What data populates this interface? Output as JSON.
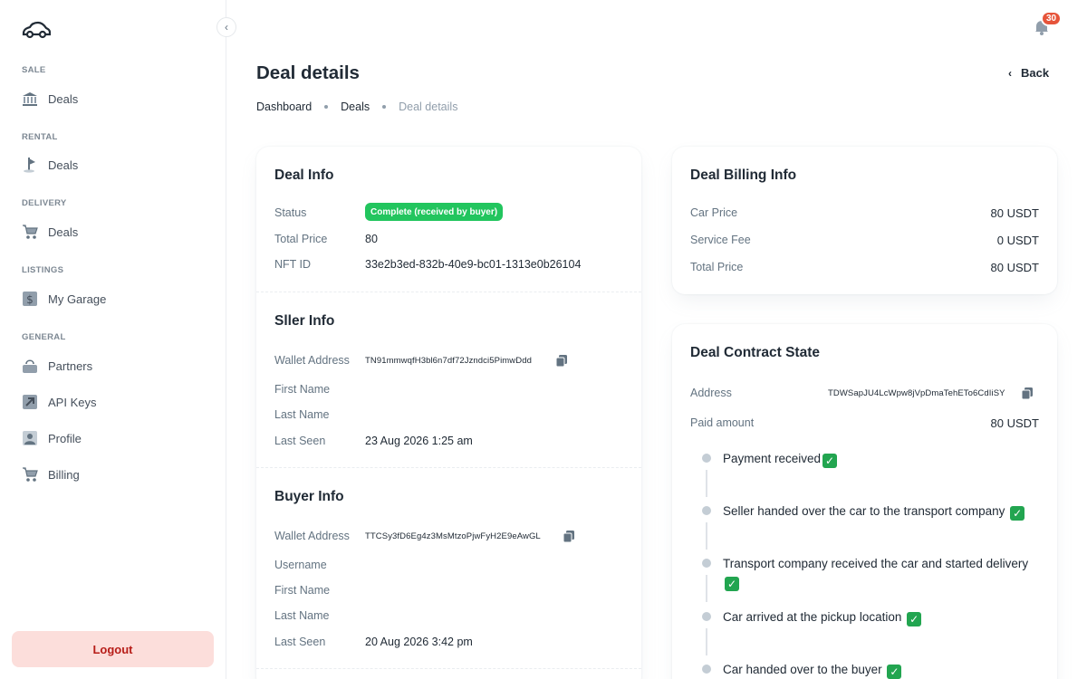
{
  "sidebar": {
    "collapse_icon": "chevron-left-icon",
    "sections": [
      {
        "label": "SALE",
        "items": [
          {
            "label": "Deals",
            "icon": "bank-icon"
          }
        ]
      },
      {
        "label": "RENTAL",
        "items": [
          {
            "label": "Deals",
            "icon": "flag-icon"
          }
        ]
      },
      {
        "label": "DELIVERY",
        "items": [
          {
            "label": "Deals",
            "icon": "cart-icon"
          }
        ]
      },
      {
        "label": "LISTINGS",
        "items": [
          {
            "label": "My Garage",
            "icon": "dollar-tag-icon"
          }
        ]
      },
      {
        "label": "GENERAL",
        "items": [
          {
            "label": "Partners",
            "icon": "bag-icon"
          },
          {
            "label": "API Keys",
            "icon": "arrow-up-right-icon"
          },
          {
            "label": "Profile",
            "icon": "user-icon"
          },
          {
            "label": "Billing",
            "icon": "cart-icon"
          }
        ]
      }
    ],
    "logout_label": "Logout"
  },
  "header": {
    "notifications_count": "30",
    "title": "Deal details",
    "back_label": "Back",
    "breadcrumb": [
      "Dashboard",
      "Deals",
      "Deal details"
    ]
  },
  "deal_info": {
    "title": "Deal Info",
    "status_label": "Status",
    "status_value": "Complete (received by buyer)",
    "total_price_label": "Total Price",
    "total_price_value": "80",
    "nft_label": "NFT ID",
    "nft_value": "33e2b3ed-832b-40e9-bc01-1313e0b26104"
  },
  "seller_info": {
    "title": "Sller Info",
    "wallet_label": "Wallet Address",
    "wallet_value": "TN91mmwqfH3bl6n7df72Jzndci5PimwDdd",
    "first_name_label": "First Name",
    "last_name_label": "Last Name",
    "last_seen_label": "Last Seen",
    "last_seen_value": "23 Aug 2026 1:25 am"
  },
  "buyer_info": {
    "title": "Buyer Info",
    "wallet_label": "Wallet Address",
    "wallet_value": "TTCSy3fD6Eg4z3MsMtzoPjwFyH2E9eAwGL",
    "username_label": "Username",
    "first_name_label": "First Name",
    "last_name_label": "Last Name",
    "last_seen_label": "Last Seen",
    "last_seen_value": "20 Aug 2026 3:42 pm"
  },
  "billing": {
    "title": "Deal Billing Info",
    "rows": [
      {
        "label": "Car Price",
        "value": "80 USDT"
      },
      {
        "label": "Service Fee",
        "value": "0 USDT"
      },
      {
        "label": "Total Price",
        "value": "80 USDT"
      }
    ]
  },
  "contract": {
    "title": "Deal Contract State",
    "address_label": "Address",
    "address_value": "TDWSapJU4LcWpw8jVpDmaTehETo6CdIiSY",
    "paid_label": "Paid amount",
    "paid_value": "80 USDT",
    "steps": [
      "Payment received",
      "Seller handed over the car to the transport company",
      "Transport company received the car and started delivery",
      "Car arrived at the pickup location",
      "Car handed over to the buyer"
    ],
    "check_glyph": "✓"
  },
  "colors": {
    "status_green": "#22c55e",
    "check_green": "#22a550",
    "badge_red": "#e6543a",
    "logout_bg": "#fcdedb",
    "logout_text": "#b71d18"
  }
}
